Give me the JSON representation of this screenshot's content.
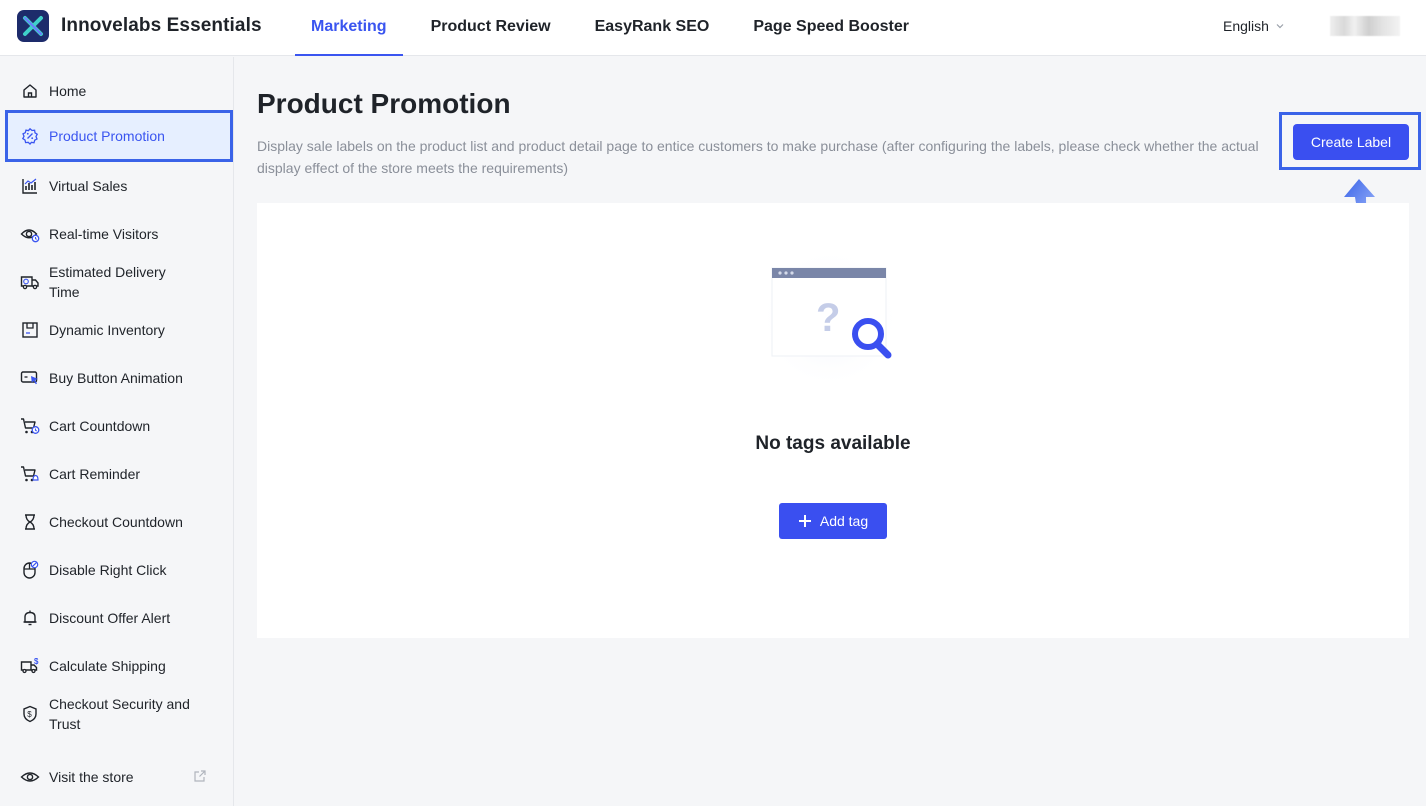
{
  "app": {
    "name": "Innovelabs Essentials"
  },
  "nav": {
    "tabs": [
      {
        "label": "Marketing",
        "active": true
      },
      {
        "label": "Product Review"
      },
      {
        "label": "EasyRank SEO"
      },
      {
        "label": "Page Speed Booster"
      }
    ]
  },
  "header": {
    "language": "English"
  },
  "sidebar": {
    "items": [
      {
        "label": "Home",
        "icon": "home-icon"
      },
      {
        "label": "Product Promotion",
        "icon": "badge-icon",
        "active": true
      },
      {
        "label": "Virtual Sales",
        "icon": "chart-icon"
      },
      {
        "label": "Real-time Visitors",
        "icon": "eye-icon"
      },
      {
        "label": "Estimated Delivery Time",
        "icon": "truck-icon"
      },
      {
        "label": "Dynamic Inventory",
        "icon": "inventory-icon"
      },
      {
        "label": "Buy Button Animation",
        "icon": "cursor-icon"
      },
      {
        "label": "Cart Countdown",
        "icon": "cart-clock-icon"
      },
      {
        "label": "Cart Reminder",
        "icon": "cart-bell-icon"
      },
      {
        "label": "Checkout Countdown",
        "icon": "hourglass-icon"
      },
      {
        "label": "Disable Right Click",
        "icon": "mouse-icon"
      },
      {
        "label": "Discount Offer Alert",
        "icon": "bell-icon"
      },
      {
        "label": "Calculate Shipping",
        "icon": "shipping-icon"
      },
      {
        "label": "Checkout Security and Trust",
        "icon": "shield-icon"
      }
    ],
    "footer": {
      "label": "Visit the store",
      "icon": "eye-icon"
    }
  },
  "main": {
    "title": "Product Promotion",
    "description": "Display sale labels on the product list and product detail page to entice customers to make purchase (after configuring the labels, please check whether the actual display effect of the store meets the requirements)",
    "create_label": "Create Label",
    "empty_text": "No tags available",
    "add_tag_label": "Add tag"
  },
  "colors": {
    "accent": "#3a4ff0",
    "highlight": "#3a63e8"
  }
}
